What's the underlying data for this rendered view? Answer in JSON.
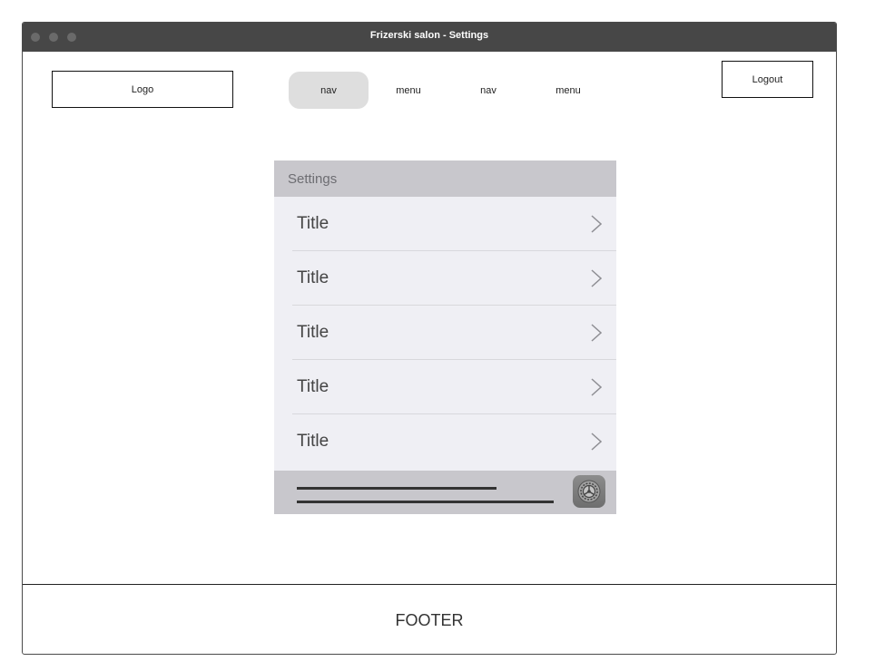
{
  "window": {
    "title": "Frizerski salon - Settings"
  },
  "header": {
    "logo": "Logo",
    "nav": [
      {
        "label": "nav",
        "active": true
      },
      {
        "label": "menu",
        "active": false
      },
      {
        "label": "nav",
        "active": false
      },
      {
        "label": "menu",
        "active": false
      }
    ],
    "logout": "Logout"
  },
  "settings_panel": {
    "header": "Settings",
    "rows": [
      {
        "title": "Title",
        "icon": "chevron-right-icon"
      },
      {
        "title": "Title",
        "icon": "chevron-right-icon"
      },
      {
        "title": "Title",
        "icon": "chevron-right-icon"
      },
      {
        "title": "Title",
        "icon": "chevron-right-icon"
      },
      {
        "title": "Title",
        "icon": "chevron-right-icon"
      }
    ],
    "footer_icon": "settings-gear-icon"
  },
  "footer": {
    "label": "FOOTER"
  },
  "colors": {
    "titlebar": "#474747",
    "panel_header": "#c8c7cc",
    "panel_bg": "#efeff4",
    "nav_active": "#dedede"
  }
}
